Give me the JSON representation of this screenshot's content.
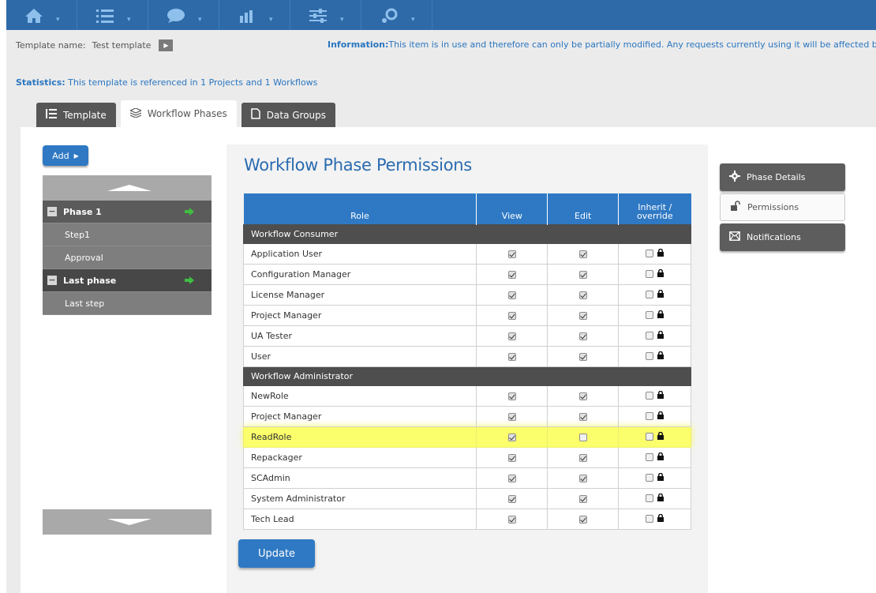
{
  "topnav": {
    "items": [
      {
        "icon": "home-icon"
      },
      {
        "icon": "list-icon"
      },
      {
        "icon": "chat-icon"
      },
      {
        "icon": "bar-chart-icon"
      },
      {
        "icon": "sliders-icon"
      },
      {
        "icon": "gear-cluster-icon"
      }
    ],
    "caret": "▾"
  },
  "template": {
    "name_label": "Template name:",
    "name_value": "Test template",
    "play": "▶"
  },
  "info": {
    "label": "Information:",
    "text": "This item is in use and therefore can only be partially modified. Any requests currently using it will be affected by the char"
  },
  "stats": {
    "label": "Statistics:",
    "text": " This template is referenced in 1 Projects and 1 Workflows"
  },
  "tabs": [
    {
      "label": "Template",
      "icon": "list-icon"
    },
    {
      "label": "Workflow Phases",
      "icon": "layers-icon"
    },
    {
      "label": "Data Groups",
      "icon": "document-icon"
    }
  ],
  "add_button": {
    "label": "Add",
    "arrow": "▶"
  },
  "tree": {
    "phases": [
      {
        "label": "Phase 1",
        "toggle": "−",
        "steps": [
          "Step1",
          "Approval"
        ]
      },
      {
        "label": "Last phase",
        "toggle": "−",
        "steps": [
          "Last step"
        ]
      }
    ]
  },
  "panel": {
    "title": "Workflow Phase Permissions",
    "columns": [
      "Role",
      "View",
      "Edit",
      "Inherit / override"
    ],
    "groups": [
      {
        "name": "Workflow Consumer",
        "rows": [
          {
            "role": "Application User",
            "view": true,
            "edit": true,
            "inherit": false
          },
          {
            "role": "Configuration Manager",
            "view": true,
            "edit": true,
            "inherit": false
          },
          {
            "role": "License Manager",
            "view": true,
            "edit": true,
            "inherit": false
          },
          {
            "role": "Project Manager",
            "view": true,
            "edit": true,
            "inherit": false
          },
          {
            "role": "UA Tester",
            "view": true,
            "edit": true,
            "inherit": false
          },
          {
            "role": "User",
            "view": true,
            "edit": true,
            "inherit": false
          }
        ]
      },
      {
        "name": "Workflow Administrator",
        "rows": [
          {
            "role": "NewRole",
            "view": true,
            "edit": true,
            "inherit": false
          },
          {
            "role": "Project Manager",
            "view": true,
            "edit": true,
            "inherit": false
          },
          {
            "role": "ReadRole",
            "view": true,
            "edit": false,
            "inherit": false,
            "highlighted": true
          },
          {
            "role": "Repackager",
            "view": true,
            "edit": true,
            "inherit": false
          },
          {
            "role": "SCAdmin",
            "view": true,
            "edit": true,
            "inherit": false
          },
          {
            "role": "System Administrator",
            "view": true,
            "edit": true,
            "inherit": false
          },
          {
            "role": "Tech Lead",
            "view": true,
            "edit": true,
            "inherit": false
          }
        ]
      }
    ],
    "update_label": "Update"
  },
  "side_nav": [
    {
      "label": "Phase Details",
      "icon": "gear-icon",
      "active": false
    },
    {
      "label": "Permissions",
      "icon": "unlock-icon",
      "active": true
    },
    {
      "label": "Notifications",
      "icon": "envelope-icon",
      "active": false
    }
  ],
  "colors": {
    "nav": "#2e6aa8",
    "accent": "#2f79c4",
    "title": "#2a6bb0",
    "highlight": "#fbff6b",
    "phase_arrow": "#3fbf3f"
  }
}
